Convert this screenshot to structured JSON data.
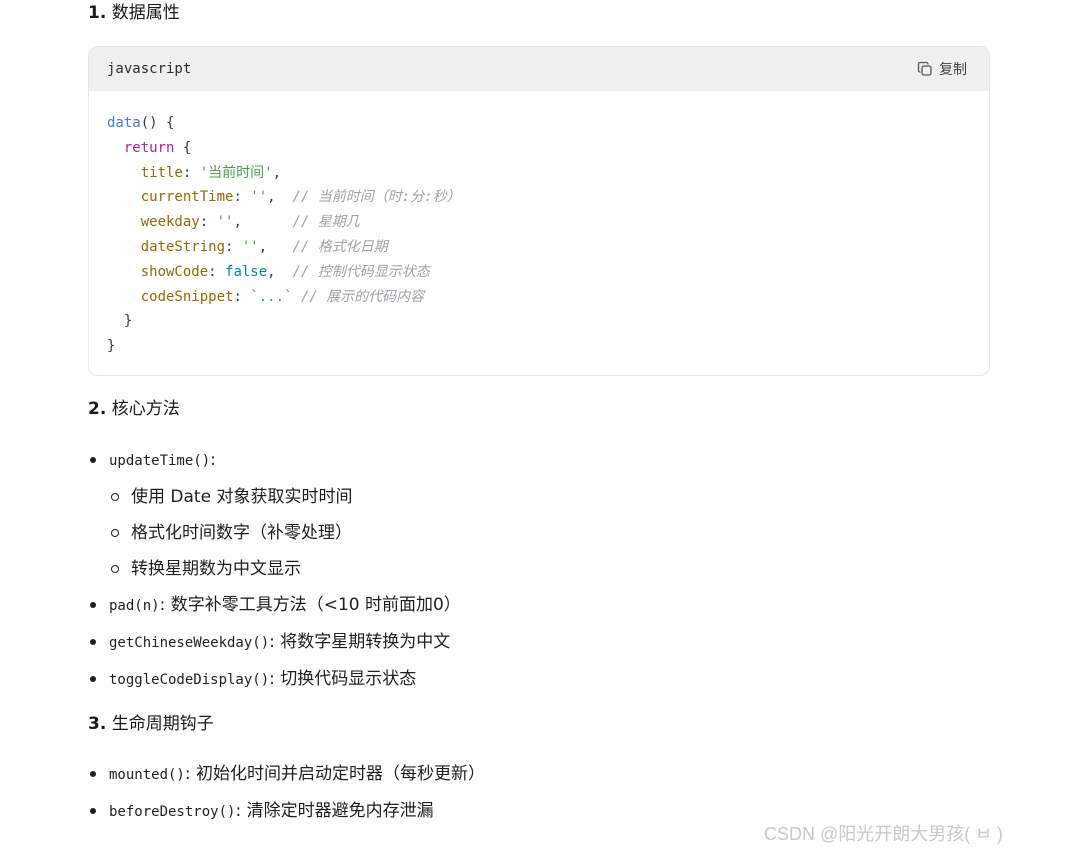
{
  "section1": {
    "num": "1.",
    "title": "数据属性"
  },
  "codeblock": {
    "language": "javascript",
    "copy_label": "复制"
  },
  "code_lines": {
    "l1": {
      "fn": "data",
      "rest": "() {"
    },
    "l2": {
      "kw": "return",
      "rest": " {"
    },
    "l3": {
      "key": "title",
      "sep": ": ",
      "val": "'当前时间'",
      "end": ","
    },
    "l4": {
      "key": "currentTime",
      "sep": ": ",
      "val": "''",
      "end": ",  ",
      "comment": "// 当前时间（时:分:秒）"
    },
    "l5": {
      "key": "weekday",
      "sep": ": ",
      "val": "''",
      "end": ",      ",
      "comment": "// 星期几"
    },
    "l6": {
      "key": "dateString",
      "sep": ": ",
      "val": "''",
      "end": ",   ",
      "comment": "// 格式化日期"
    },
    "l7": {
      "key": "showCode",
      "sep": ": ",
      "val": "false",
      "end": ",  ",
      "comment": "// 控制代码显示状态"
    },
    "l8": {
      "key": "codeSnippet",
      "sep": ": ",
      "val": "`...`",
      "end": " ",
      "comment": "// 展示的代码内容"
    },
    "l9": "}",
    "l10": "}"
  },
  "section2": {
    "num": "2.",
    "title": "核心方法",
    "items": [
      {
        "code": "updateTime()",
        "text": ":",
        "sub": [
          "使用 Date 对象获取实时时间",
          "格式化时间数字（补零处理）",
          "转换星期数为中文显示"
        ]
      },
      {
        "code": "pad(n)",
        "text": ": 数字补零工具方法（<10 时前面加0）"
      },
      {
        "code": "getChineseWeekday()",
        "text": ": 将数字星期转换为中文"
      },
      {
        "code": "toggleCodeDisplay()",
        "text": ": 切换代码显示状态"
      }
    ]
  },
  "section3": {
    "num": "3.",
    "title": "生命周期钩子",
    "items": [
      {
        "code": "mounted()",
        "text": ": 初始化时间并启动定时器（每秒更新）"
      },
      {
        "code": "beforeDestroy()",
        "text": ": 清除定时器避免内存泄漏"
      }
    ]
  },
  "watermark": "CSDN @阳光开朗大男孩(   ㅂ  )"
}
